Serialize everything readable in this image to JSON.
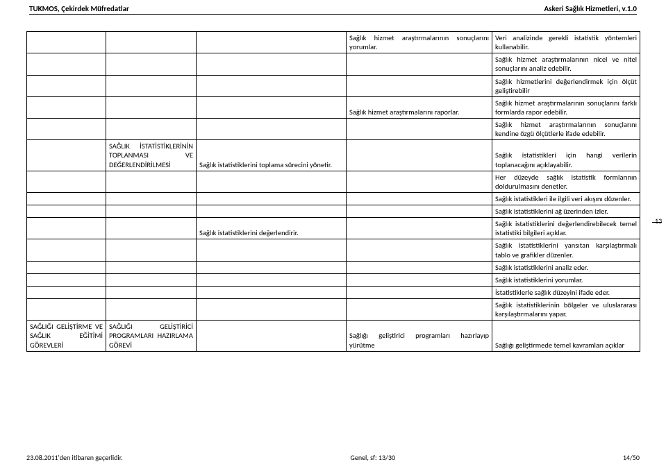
{
  "header": {
    "left": "TUKMOS, Çekirdek Müfredatlar",
    "right": "Askeri Sağlık Hizmetleri, v.1.0"
  },
  "rows": {
    "r0_c3": "Sağlık hizmet araştırmalarının sonuçlarını yorumlar.",
    "r0_c4": "Veri analizinde gerekli istatistik yöntemleri kullanabilir.",
    "r1_c4": "Sağlık hizmet araştırmalarının nicel ve nitel sonuçlarını analiz edebilir.",
    "r2_c4": "Sağlık hizmetlerini değerlendirmek için ölçüt geliştirebilir",
    "r3_c3": "Sağlık hizmet araştırmalarını raporlar.",
    "r3_c4": "Sağlık hizmet araştırmalarının sonuçlarını farklı formlarda rapor edebilir.",
    "r4_c4": "Sağlık hizmet araştırmalarının sonuçlarını kendine özgü ölçütlerle ifade edebilir.",
    "r5_c1": "SAĞLIK İSTATİSTİKLERİNİN TOPLANMASI VE DEĞERLENDİRİLMESİ",
    "r5_c2": "Sağlık istatistiklerini toplama sürecini yönetir.",
    "r5_c4": "Sağlık istatistikleri için hangi verilerin toplanacağını açıklayabilir.",
    "r6_c4": "Her düzeyde sağlık istatistik formlarının doldurulmasını denetler.",
    "r7_c4": "Sağlık istatistikleri ile ilgili veri akışını düzenler.",
    "r8_c4": "Sağlık istatistiklerini ağ üzerinden izler.",
    "r9_c2": "Sağlık istatistiklerini değerlendirir.",
    "r9_c4": "Sağlık istatistiklerini değerlendirebilecek temel istatistiki bilgileri açıklar.",
    "r10_c4": "Sağlık istatistiklerini yansıtan karşılaştırmalı tablo ve grafikler düzenler.",
    "r11_c4": "Sağlık istatistiklerini analiz eder.",
    "r12_c4": "Sağlık istatistiklerini yorumlar.",
    "r13_c4": "İstatistiklerle sağlık düzeyini ifade eder.",
    "r14_c4": "Sağlık istatistiklerinin bölgeler ve uluslararası karşılaştırmalarını yapar.",
    "r15_c0": "SAĞLIĞI GELİŞTİRME VE SAĞLIK EĞİTİMİ GÖREVLERİ",
    "r15_c1": "SAĞLIĞI GELİŞTİRİCİ PROGRAMLARI HAZIRLAMA GÖREVİ",
    "r15_c3": "Sağlığı geliştirici programları hazırlayıp yürütme",
    "r15_c4": "Sağlığı geliştirmede temel kavramları açıklar"
  },
  "side_page_fragment": "13",
  "footer": {
    "left": "23.08.2011'den itibaren geçerlidir.",
    "center": "Genel, sf: 13/30",
    "right": "14/50"
  }
}
